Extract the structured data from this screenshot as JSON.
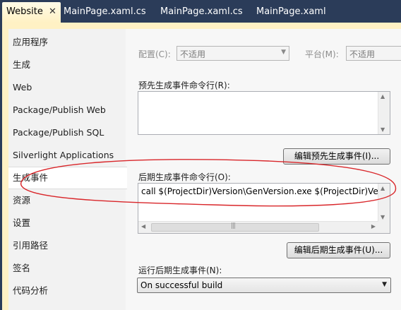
{
  "tabs": [
    {
      "label": "Website",
      "active": true,
      "close": "✕"
    },
    {
      "label": "MainPage.xaml.cs"
    },
    {
      "label": "MainPage.xaml.cs"
    },
    {
      "label": "MainPage.xaml"
    }
  ],
  "sidebar": {
    "items": [
      {
        "label": "应用程序"
      },
      {
        "label": "生成"
      },
      {
        "label": "Web"
      },
      {
        "label": "Package/Publish Web"
      },
      {
        "label": "Package/Publish SQL"
      },
      {
        "label": "Silverlight Applications"
      },
      {
        "label": "生成事件",
        "selected": true
      },
      {
        "label": "资源"
      },
      {
        "label": "设置"
      },
      {
        "label": "引用路径"
      },
      {
        "label": "签名"
      },
      {
        "label": "代码分析"
      }
    ]
  },
  "config": {
    "label": "配置(C):",
    "value": "不适用",
    "platform_label": "平台(M):",
    "platform_value": "不适用"
  },
  "prebuild": {
    "label": "预先生成事件命令行(R):",
    "value": "",
    "edit_button": "编辑预先生成事件(I)..."
  },
  "postbuild": {
    "label": "后期生成事件命令行(O):",
    "value": "call $(ProjectDir)Version\\GenVersion.exe $(ProjectDir)Version",
    "edit_button": "编辑后期生成事件(U)..."
  },
  "run_postbuild": {
    "label": "运行后期生成事件(N):",
    "value": "On successful build"
  },
  "colors": {
    "tab_bar": "#2b3c59",
    "active_tab": "#fff1c4",
    "annotation": "#d9262a"
  },
  "icons": {
    "close": "close-icon",
    "dropdown": "chevron-down-icon",
    "scroll_up": "arrow-up-icon",
    "scroll_down": "arrow-down-icon",
    "scroll_left": "arrow-left-icon",
    "scroll_right": "arrow-right-icon"
  }
}
